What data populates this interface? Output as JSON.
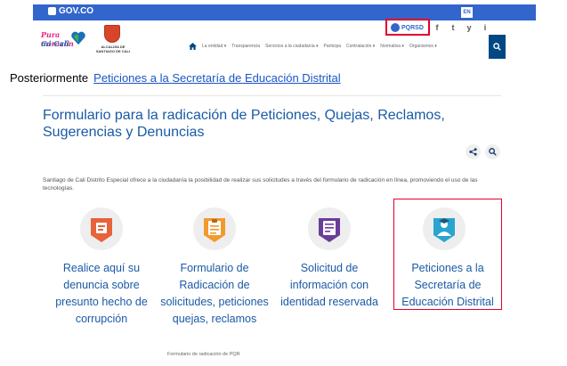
{
  "gov_bar": {
    "logo_label": "GOV.CO",
    "lang_label": "EN"
  },
  "logos": {
    "brand_line1": "Pura Corazón",
    "brand_line2": "mi Cali",
    "alcaldia_text": "ALCALDÍA DE SANTIAGO DE CALI"
  },
  "header": {
    "pqrsd_label": "PQRSD",
    "social": [
      "f",
      "t",
      "y",
      "i"
    ],
    "social_icons": [
      "facebook-icon",
      "twitter-icon",
      "youtube-icon",
      "instagram-icon"
    ],
    "nav_items": [
      "La entidad ▾",
      "Transparencia",
      "Servicios a la ciudadanía ▾",
      "Participa",
      "Contratación ▾",
      "Normativa ▾",
      "Organismos ▾"
    ]
  },
  "annotation": {
    "prefix": "Posteriormente",
    "link": "Peticiones a la Secretaría de Educación Distrital"
  },
  "main": {
    "title": "Formulario para la radicación de Peticiones, Quejas, Reclamos, Sugerencias y Denuncias",
    "description": "Santiago de Cali Distrito Especial ofrece a la ciudadanía la posibilidad de realizar sus solicitudes a través del formulario de radicación en línea, promoviendo el uso de las tecnologías.",
    "cards": [
      {
        "label": "Realice aquí su denuncia sobre presunto hecho de corrupción",
        "color": "#e8623a",
        "icon": "corruption-report-icon"
      },
      {
        "label": "Formulario de Radicación de solicitudes, peticiones quejas, reclamos",
        "color": "#f29a2e",
        "icon": "clipboard-form-icon"
      },
      {
        "label": "Solicitud de información con identidad reservada",
        "color": "#6a3d9a",
        "icon": "reserved-identity-document-icon"
      },
      {
        "label": "Peticiones a la Secretaría de Educación Distrital",
        "color": "#2aa4d0",
        "icon": "education-petition-icon"
      }
    ],
    "footer_link": "Formulario de radicación de PQR"
  },
  "colors": {
    "gov_blue": "#3366cc",
    "title_blue": "#1a5aa6",
    "highlight_red": "#e4002b",
    "nav_search_bg": "#004884"
  }
}
